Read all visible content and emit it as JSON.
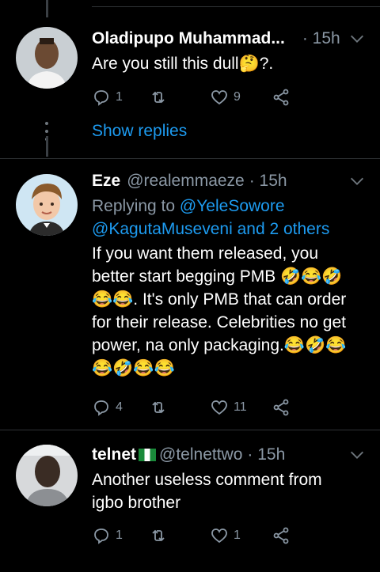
{
  "tweets": [
    {
      "name": "Oladipupo Muhammad...",
      "handle": "",
      "time": "· 15h",
      "text": "Are you still this dull🤔?.",
      "counts": {
        "replies": "1",
        "retweets": "",
        "likes": "9"
      }
    },
    {
      "name": "Eze",
      "handle": "@realemmaeze",
      "time": "· 15h",
      "replying_prefix": "Replying to ",
      "replying_to": "@YeleSowore",
      "replying_line2": "@KagutaMuseveni and 2 others",
      "text_lines": [
        "If you want them released, you",
        "better start begging PMB 🤣😂🤣",
        "😂😂. It's only PMB that can order",
        "for their release.  Celebrities no get",
        "power, na only packaging.😂🤣😂",
        "😂🤣😂😂"
      ],
      "counts": {
        "replies": "4",
        "retweets": "",
        "likes": "11"
      }
    },
    {
      "name": "telnet",
      "handle": "@telnettwo",
      "time": "· 15h",
      "text_lines": [
        "Another useless comment from",
        "igbo brother"
      ],
      "counts": {
        "replies": "1",
        "retweets": "",
        "likes": "1"
      }
    }
  ],
  "show_replies": "Show replies",
  "icons": [
    "reply-icon",
    "retweet-icon",
    "like-icon",
    "share-icon",
    "chevron-down-icon"
  ],
  "colors": {
    "accent": "#1d9bf0",
    "muted": "#8b98a5",
    "background": "#000000"
  }
}
